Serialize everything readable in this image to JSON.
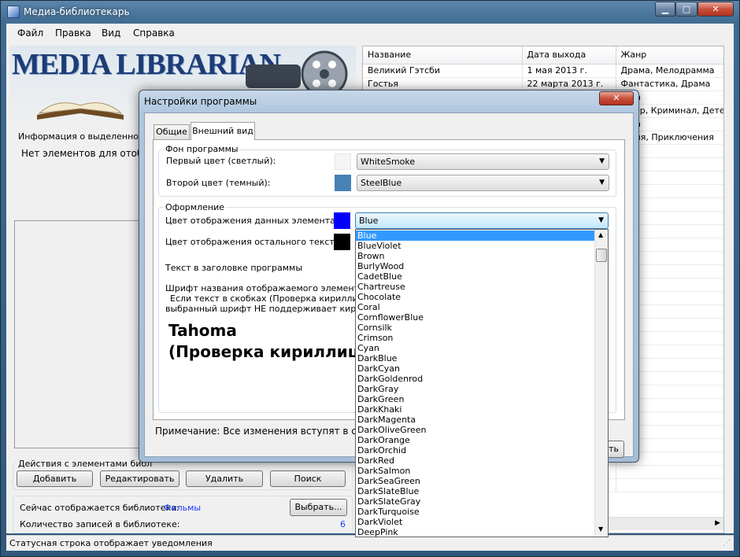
{
  "main_window": {
    "title": "Медиа-библиотекарь",
    "controls": {
      "minimize": "▁",
      "maximize": "□",
      "close": "✕"
    }
  },
  "menu": [
    "Файл",
    "Правка",
    "Вид",
    "Справка"
  ],
  "logo": {
    "text": "MEDIA LIBRARIAN"
  },
  "info_panel": {
    "label": "Информация о выделенном за",
    "empty_text": "Нет элементов для отобр"
  },
  "grid": {
    "columns": [
      "Название",
      "Дата выхода",
      "Жанр"
    ],
    "rows": [
      [
        "Великий Гэтсби",
        "1 мая 2013 г.",
        "Драма, Мелодрамма"
      ],
      [
        "Гостья",
        "22 марта 2013 г.",
        "Фантастика, Драма"
      ],
      [
        "",
        "",
        "...ма"
      ],
      [
        "",
        "",
        "...лер, Криминал, Дете"
      ],
      [
        "",
        "",
        "...ма"
      ],
      [
        "",
        "",
        "...дия, Приключения"
      ]
    ]
  },
  "actions": {
    "legend": "Действия с элементами библ",
    "add": "Добавить",
    "edit": "Редактировать",
    "delete": "Удалить",
    "search": "Поиск"
  },
  "library": {
    "current_label": "Сейчас отображается библиотека:",
    "current_value": "Фильмы",
    "choose": "Выбрать...",
    "count_label": "Количество записей в библиотеке:",
    "count_value": "6"
  },
  "statusbar": {
    "text": "Статусная строка отображает уведомления"
  },
  "dialog": {
    "title": "Настройки программы",
    "close": "✕",
    "tabs": [
      "Общие",
      "Внешний вид"
    ],
    "background_group": {
      "legend": "Фон программы",
      "first_label": "Первый цвет (светлый):",
      "first_value": "WhiteSmoke",
      "second_label": "Второй цвет (темный):",
      "second_value": "SteelBlue"
    },
    "design_group": {
      "legend": "Оформление",
      "item_color_label": "Цвет отображения данных элемента:",
      "item_color_value": "Blue",
      "other_color_label": "Цвет отображения остального текста:",
      "header_text_label": "Текст в заголовке программы",
      "font_label": "Шрифт названия отображаемого элемента:",
      "font_note_1": "Если текст в скобках (Проверка кириллицы) о",
      "font_note_2": "выбранный шрифт НЕ поддерживает кириллицу",
      "font_preview_1": "Tahoma",
      "font_preview_2": "(Проверка кириллиц"
    },
    "note": "Примечание: Все изменения вступят в сил",
    "apply_button": "ть"
  },
  "dropdown": {
    "items": [
      "Blue",
      "BlueViolet",
      "Brown",
      "BurlyWood",
      "CadetBlue",
      "Chartreuse",
      "Chocolate",
      "Coral",
      "CornflowerBlue",
      "Cornsilk",
      "Crimson",
      "Cyan",
      "DarkBlue",
      "DarkCyan",
      "DarkGoldenrod",
      "DarkGray",
      "DarkGreen",
      "DarkKhaki",
      "DarkMagenta",
      "DarkOliveGreen",
      "DarkOrange",
      "DarkOrchid",
      "DarkRed",
      "DarkSalmon",
      "DarkSeaGreen",
      "DarkSlateBlue",
      "DarkSlateGray",
      "DarkTurquoise",
      "DarkViolet",
      "DeepPink"
    ],
    "selected": "Blue"
  },
  "colors": {
    "swatch_first": "#f5f5f5",
    "swatch_second": "#4682b4",
    "swatch_item": "#0000ff",
    "swatch_other": "#000000",
    "selection": "#3399ff",
    "link_blue": "#1a3cff"
  }
}
